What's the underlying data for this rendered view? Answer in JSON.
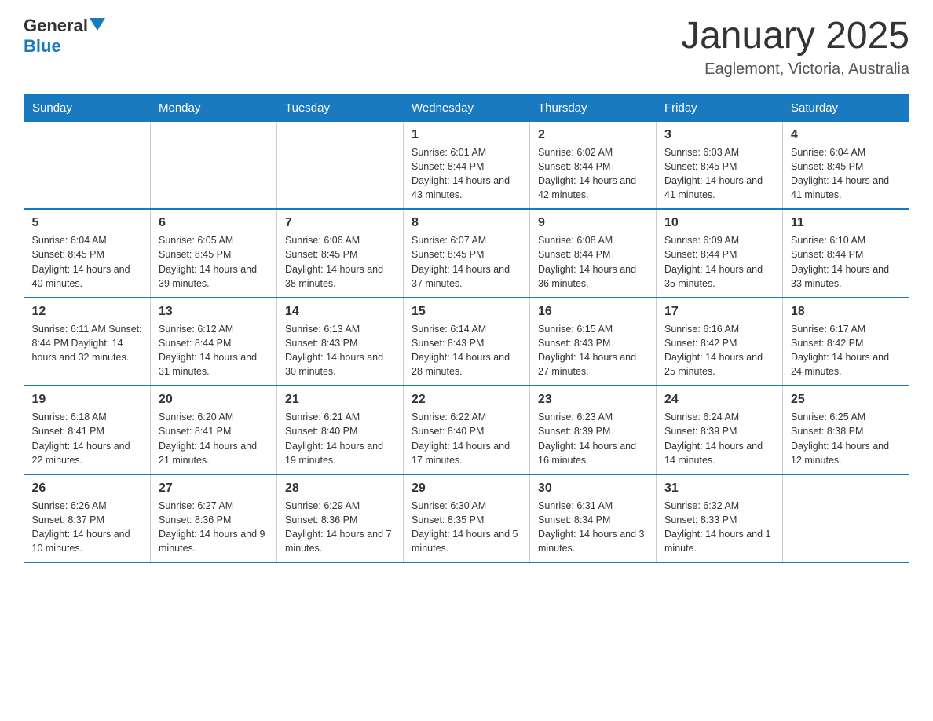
{
  "header": {
    "logo_general": "General",
    "logo_blue": "Blue",
    "title": "January 2025",
    "subtitle": "Eaglemont, Victoria, Australia"
  },
  "days_of_week": [
    "Sunday",
    "Monday",
    "Tuesday",
    "Wednesday",
    "Thursday",
    "Friday",
    "Saturday"
  ],
  "weeks": [
    [
      {
        "day": "",
        "info": ""
      },
      {
        "day": "",
        "info": ""
      },
      {
        "day": "",
        "info": ""
      },
      {
        "day": "1",
        "info": "Sunrise: 6:01 AM\nSunset: 8:44 PM\nDaylight: 14 hours and 43 minutes."
      },
      {
        "day": "2",
        "info": "Sunrise: 6:02 AM\nSunset: 8:44 PM\nDaylight: 14 hours and 42 minutes."
      },
      {
        "day": "3",
        "info": "Sunrise: 6:03 AM\nSunset: 8:45 PM\nDaylight: 14 hours and 41 minutes."
      },
      {
        "day": "4",
        "info": "Sunrise: 6:04 AM\nSunset: 8:45 PM\nDaylight: 14 hours and 41 minutes."
      }
    ],
    [
      {
        "day": "5",
        "info": "Sunrise: 6:04 AM\nSunset: 8:45 PM\nDaylight: 14 hours and 40 minutes."
      },
      {
        "day": "6",
        "info": "Sunrise: 6:05 AM\nSunset: 8:45 PM\nDaylight: 14 hours and 39 minutes."
      },
      {
        "day": "7",
        "info": "Sunrise: 6:06 AM\nSunset: 8:45 PM\nDaylight: 14 hours and 38 minutes."
      },
      {
        "day": "8",
        "info": "Sunrise: 6:07 AM\nSunset: 8:45 PM\nDaylight: 14 hours and 37 minutes."
      },
      {
        "day": "9",
        "info": "Sunrise: 6:08 AM\nSunset: 8:44 PM\nDaylight: 14 hours and 36 minutes."
      },
      {
        "day": "10",
        "info": "Sunrise: 6:09 AM\nSunset: 8:44 PM\nDaylight: 14 hours and 35 minutes."
      },
      {
        "day": "11",
        "info": "Sunrise: 6:10 AM\nSunset: 8:44 PM\nDaylight: 14 hours and 33 minutes."
      }
    ],
    [
      {
        "day": "12",
        "info": "Sunrise: 6:11 AM\nSunset: 8:44 PM\nDaylight: 14 hours and 32 minutes."
      },
      {
        "day": "13",
        "info": "Sunrise: 6:12 AM\nSunset: 8:44 PM\nDaylight: 14 hours and 31 minutes."
      },
      {
        "day": "14",
        "info": "Sunrise: 6:13 AM\nSunset: 8:43 PM\nDaylight: 14 hours and 30 minutes."
      },
      {
        "day": "15",
        "info": "Sunrise: 6:14 AM\nSunset: 8:43 PM\nDaylight: 14 hours and 28 minutes."
      },
      {
        "day": "16",
        "info": "Sunrise: 6:15 AM\nSunset: 8:43 PM\nDaylight: 14 hours and 27 minutes."
      },
      {
        "day": "17",
        "info": "Sunrise: 6:16 AM\nSunset: 8:42 PM\nDaylight: 14 hours and 25 minutes."
      },
      {
        "day": "18",
        "info": "Sunrise: 6:17 AM\nSunset: 8:42 PM\nDaylight: 14 hours and 24 minutes."
      }
    ],
    [
      {
        "day": "19",
        "info": "Sunrise: 6:18 AM\nSunset: 8:41 PM\nDaylight: 14 hours and 22 minutes."
      },
      {
        "day": "20",
        "info": "Sunrise: 6:20 AM\nSunset: 8:41 PM\nDaylight: 14 hours and 21 minutes."
      },
      {
        "day": "21",
        "info": "Sunrise: 6:21 AM\nSunset: 8:40 PM\nDaylight: 14 hours and 19 minutes."
      },
      {
        "day": "22",
        "info": "Sunrise: 6:22 AM\nSunset: 8:40 PM\nDaylight: 14 hours and 17 minutes."
      },
      {
        "day": "23",
        "info": "Sunrise: 6:23 AM\nSunset: 8:39 PM\nDaylight: 14 hours and 16 minutes."
      },
      {
        "day": "24",
        "info": "Sunrise: 6:24 AM\nSunset: 8:39 PM\nDaylight: 14 hours and 14 minutes."
      },
      {
        "day": "25",
        "info": "Sunrise: 6:25 AM\nSunset: 8:38 PM\nDaylight: 14 hours and 12 minutes."
      }
    ],
    [
      {
        "day": "26",
        "info": "Sunrise: 6:26 AM\nSunset: 8:37 PM\nDaylight: 14 hours and 10 minutes."
      },
      {
        "day": "27",
        "info": "Sunrise: 6:27 AM\nSunset: 8:36 PM\nDaylight: 14 hours and 9 minutes."
      },
      {
        "day": "28",
        "info": "Sunrise: 6:29 AM\nSunset: 8:36 PM\nDaylight: 14 hours and 7 minutes."
      },
      {
        "day": "29",
        "info": "Sunrise: 6:30 AM\nSunset: 8:35 PM\nDaylight: 14 hours and 5 minutes."
      },
      {
        "day": "30",
        "info": "Sunrise: 6:31 AM\nSunset: 8:34 PM\nDaylight: 14 hours and 3 minutes."
      },
      {
        "day": "31",
        "info": "Sunrise: 6:32 AM\nSunset: 8:33 PM\nDaylight: 14 hours and 1 minute."
      },
      {
        "day": "",
        "info": ""
      }
    ]
  ]
}
